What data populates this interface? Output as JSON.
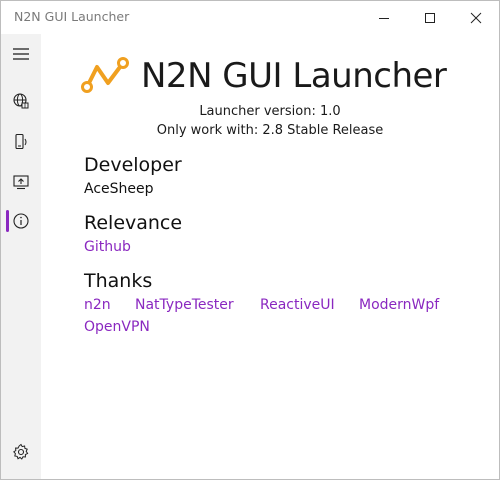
{
  "window": {
    "title": "N2N GUI Launcher",
    "controls": {
      "minimize_icon": "minimize-icon",
      "maximize_icon": "maximize-icon",
      "close_icon": "close-icon"
    }
  },
  "sidebar": {
    "items": [
      {
        "icon": "hamburger-menu-icon"
      },
      {
        "icon": "network-globe-icon"
      },
      {
        "icon": "device-icon"
      },
      {
        "icon": "share-screen-icon"
      },
      {
        "icon": "info-icon",
        "selected": true
      },
      {
        "icon": "gear-icon"
      }
    ],
    "accent": "#8a28c0"
  },
  "about": {
    "app_title": "N2N GUI Launcher",
    "launcher_version": "Launcher version: 1.0",
    "compatibility": "Only work with: 2.8 Stable Release",
    "developer": {
      "heading": "Developer",
      "name": "AceSheep"
    },
    "relevance": {
      "heading": "Relevance",
      "links": [
        "Github"
      ]
    },
    "thanks": {
      "heading": "Thanks",
      "links": [
        "n2n",
        "NatTypeTester",
        "ReactiveUI",
        "ModernWpf",
        "OpenVPN"
      ]
    }
  },
  "colors": {
    "link": "#8a28c0",
    "logo": "#f0a020",
    "sidebar_bg": "#f2f2f2"
  }
}
